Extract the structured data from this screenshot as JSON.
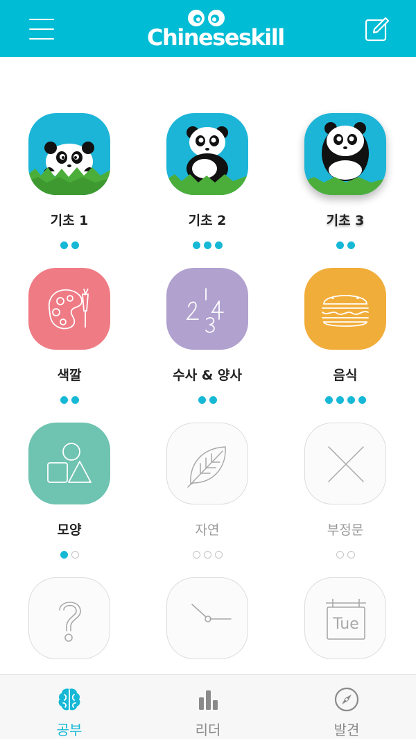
{
  "header": {
    "logo_text": "Chineseskill",
    "menu_icon": "hamburger-menu-icon",
    "edit_icon": "edit-pencil-icon",
    "background_color": "#00bcd4"
  },
  "lessons": [
    {
      "label": "기초 1",
      "icon": "panda-peek-icon",
      "locked": false,
      "dots": [
        1,
        1
      ]
    },
    {
      "label": "기초 2",
      "icon": "panda-sitting-icon",
      "locked": false,
      "dots": [
        1,
        1,
        1
      ]
    },
    {
      "label": "기초 3",
      "icon": "panda-standing-icon",
      "locked": false,
      "dots": [
        1,
        1
      ]
    },
    {
      "label": "색깔",
      "icon": "palette-icon",
      "locked": false,
      "dots": [
        1,
        1
      ],
      "color": "#ef7b85"
    },
    {
      "label": "수사 & 양사",
      "icon": "numbers-icon",
      "locked": false,
      "dots": [
        1,
        1
      ],
      "color": "#b0a1cf"
    },
    {
      "label": "음식",
      "icon": "burger-icon",
      "locked": false,
      "dots": [
        1,
        1,
        1,
        1
      ],
      "color": "#f1ad3a"
    },
    {
      "label": "모양",
      "icon": "shapes-icon",
      "locked": false,
      "dots": [
        1,
        0
      ],
      "color": "#6ec3b1"
    },
    {
      "label": "자연",
      "icon": "leaf-icon",
      "locked": true,
      "dots": [
        0,
        0,
        0
      ]
    },
    {
      "label": "부정문",
      "icon": "cross-icon",
      "locked": true,
      "dots": [
        0,
        0
      ]
    },
    {
      "label": "",
      "icon": "question-icon",
      "locked": true,
      "dots": []
    },
    {
      "label": "",
      "icon": "clock-icon",
      "locked": true,
      "dots": []
    },
    {
      "label": "",
      "icon": "calendar-tue-icon",
      "locked": true,
      "dots": [],
      "calendar_text": "Tue"
    }
  ],
  "bottom_nav": [
    {
      "label": "공부",
      "icon": "brain-icon",
      "active": true
    },
    {
      "label": "리더",
      "icon": "bar-chart-icon",
      "active": false
    },
    {
      "label": "발견",
      "icon": "compass-icon",
      "active": false
    }
  ],
  "colors": {
    "accent": "#16b8d6",
    "locked_text": "#9a9a9a"
  }
}
